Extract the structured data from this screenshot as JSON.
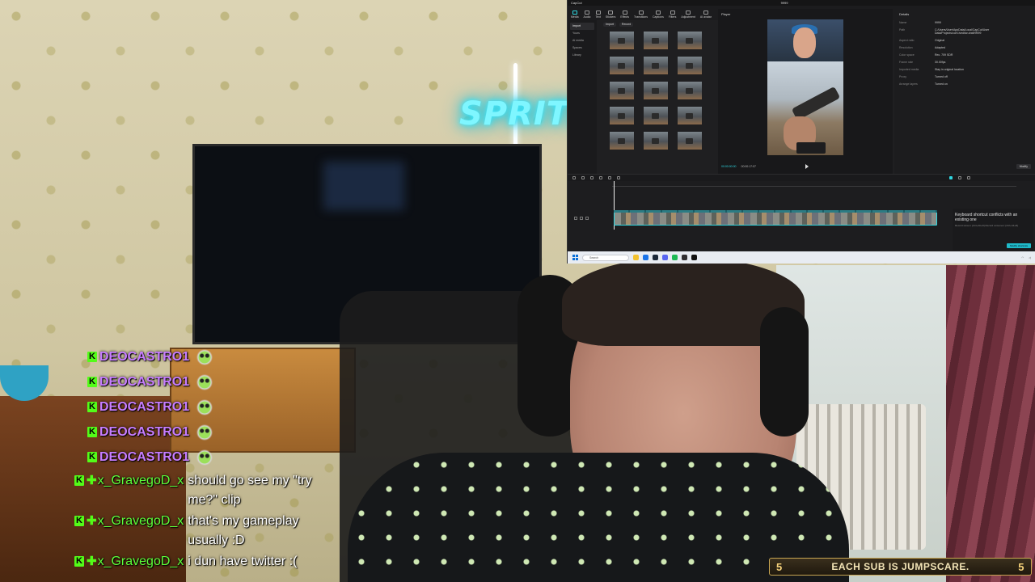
{
  "editor": {
    "window_title": "CapCut",
    "project_name": "9999",
    "toolbar": [
      "Media",
      "Audio",
      "Text",
      "Stickers",
      "Effects",
      "Transitions",
      "Captions",
      "Filters",
      "Adjustment",
      "AI avatar"
    ],
    "left_nav": [
      "Import",
      "Yours",
      "AI media",
      "Spaces",
      "Library"
    ],
    "media_tabs": [
      "Import",
      "Record"
    ],
    "player_label": "Player",
    "timecode_current": "00:00:00:00",
    "timecode_total": "00:00:17:07",
    "details": {
      "title": "Details",
      "rows": [
        {
          "k": "Name",
          "v": "9999"
        },
        {
          "k": "Path",
          "v": "C:/Users/User/AppData/Local/CapCut/User Data/Projects/com.lveditor.draft/9999"
        },
        {
          "k": "Aspect ratio",
          "v": "Original"
        },
        {
          "k": "Resolution",
          "v": "Adapted"
        },
        {
          "k": "Color space",
          "v": "Rec. 709 SDR"
        },
        {
          "k": "Frame rate",
          "v": "30.00fps"
        },
        {
          "k": "Imported media",
          "v": "Stay in original location"
        },
        {
          "k": "Proxy",
          "v": "Turned off"
        },
        {
          "k": "Arrange layers",
          "v": "Turned on"
        }
      ],
      "modify_label": "Modify"
    },
    "toast": {
      "message": "Keyboard shortcut conflicts with an existing one",
      "sub": "Record screen: [Ctrl+Alt+R] Record voiceover: [Ctrl+Alt+R]",
      "button": "Modify shortcuts"
    },
    "taskbar": {
      "search_placeholder": "Search"
    }
  },
  "chat": {
    "spam_user": "DEOCASTRO1",
    "spam_count": 5,
    "messages": [
      {
        "user": "x_GravegoD_x",
        "text": "should go see my \"try me?\" clip"
      },
      {
        "user": "x_GravegoD_x",
        "text": "that's my gameplay usually :D"
      },
      {
        "user": "x_GravegoD_x",
        "text": "i dun have twitter :("
      }
    ]
  },
  "banner": {
    "count_left": "5",
    "text": "EACH SUB IS JUMPSCARE.",
    "count_right": "5"
  },
  "neon_sign": "SPRITIS",
  "colors": {
    "kick_green": "#53fc18",
    "spam_name": "#c77dff",
    "accent": "#2fd6e0"
  }
}
